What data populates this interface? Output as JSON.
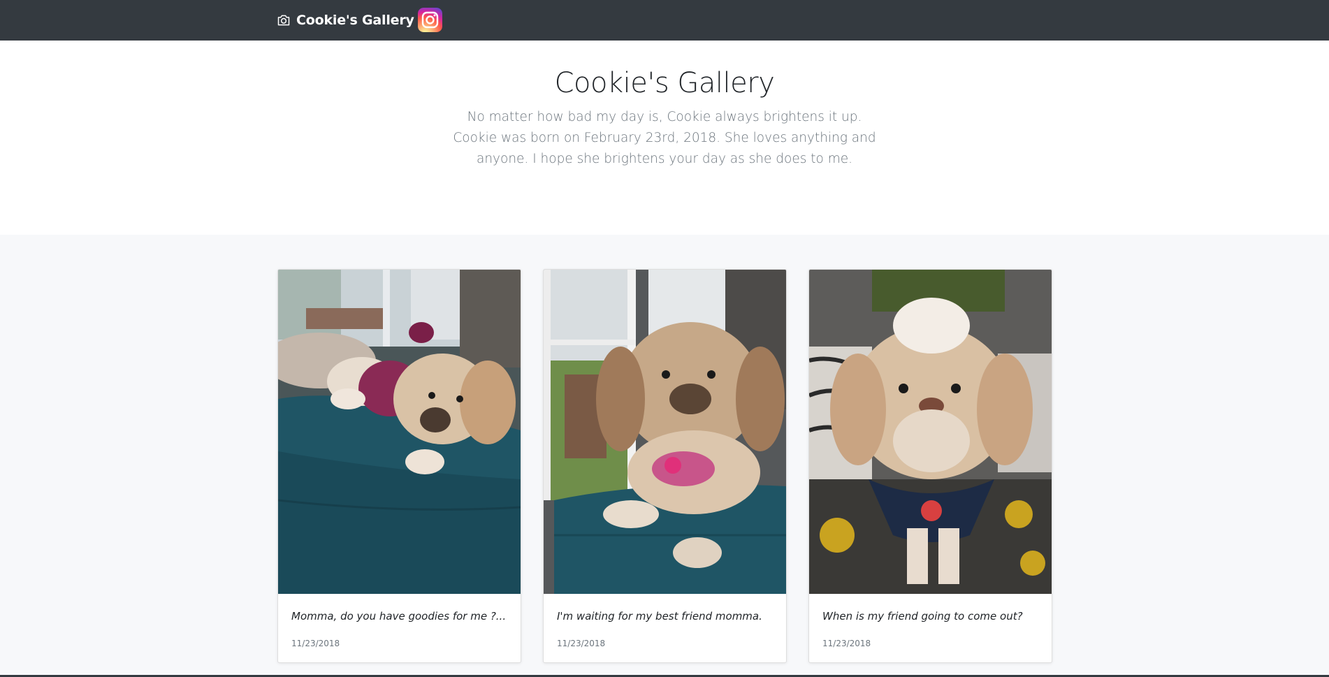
{
  "navbar": {
    "brand_icon": "camera-icon",
    "brand_text": "Cookie's Gallery",
    "instagram_icon": "instagram-icon",
    "background": "#343a40"
  },
  "jumbotron": {
    "title": "Cookie's Gallery",
    "lead": "No matter how bad my day is, Cookie always brightens it up. Cookie was born on February 23rd, 2018. She loves anything and anyone. I hope she brightens your day as she does to me."
  },
  "gallery": {
    "cards": [
      {
        "caption": "Momma, do you have goodies for me ?...",
        "date": "11/23/2018"
      },
      {
        "caption": "I'm waiting for my best friend momma.",
        "date": "11/23/2018"
      },
      {
        "caption": "When is my friend going to come out?",
        "date": "11/23/2018"
      }
    ]
  }
}
